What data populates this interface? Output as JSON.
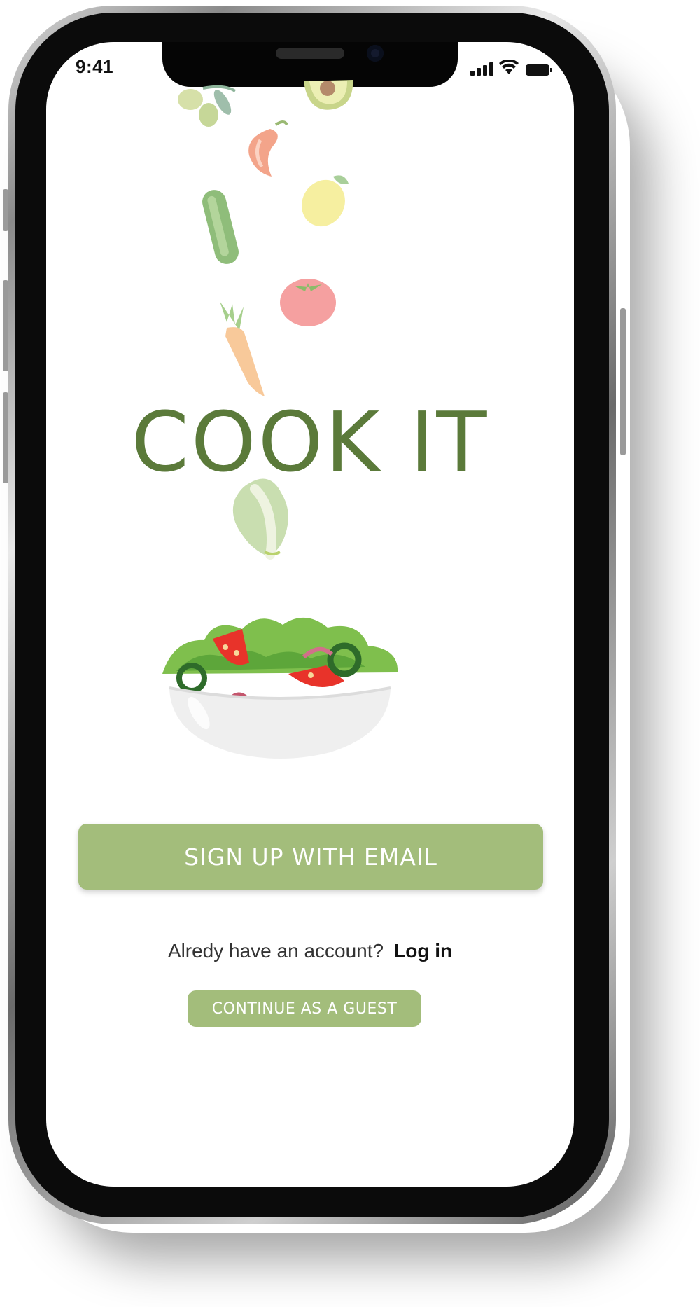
{
  "status_bar": {
    "time": "9:41",
    "icons": [
      "signal-icon",
      "wifi-icon",
      "battery-icon"
    ]
  },
  "app": {
    "title": "COOK IT",
    "brand_color": "#5b7a3a",
    "accent_color": "#a3bd7b"
  },
  "illustrations": [
    "olives",
    "avocado",
    "chili-pepper",
    "lemon",
    "cucumber",
    "tomato",
    "carrot",
    "lettuce",
    "salad-bowl"
  ],
  "actions": {
    "signup_label": "SIGN UP WITH EMAIL",
    "account_prompt": "Alredy have an account?",
    "login_label": "Log in",
    "guest_label": "CONTINUE AS A GUEST"
  }
}
